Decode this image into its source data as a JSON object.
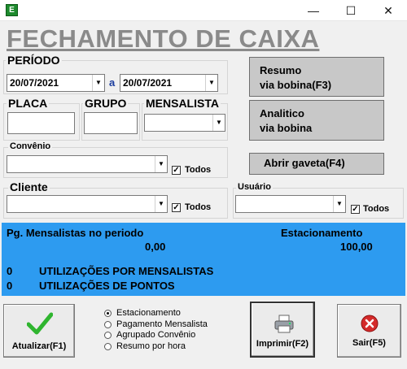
{
  "window": {
    "app_icon": "E",
    "minimize_glyph": "—",
    "maximize_glyph": "☐",
    "close_glyph": "✕"
  },
  "title": "FECHAMENTO DE CAIXA",
  "periodo": {
    "label": "PERÍODO",
    "from": "20/07/2021",
    "separator": "a",
    "to": "20/07/2021"
  },
  "placa": {
    "label": "PLACA",
    "value": ""
  },
  "grupo": {
    "label": "GRUPO",
    "value": ""
  },
  "mensalista": {
    "label": "MENSALISTA",
    "value": ""
  },
  "convenio": {
    "label": "Convênio",
    "value": "",
    "todos_label": "Todos",
    "todos_checked": true
  },
  "cliente": {
    "label": "Cliente",
    "value": "",
    "todos_label": "Todos",
    "todos_checked": true
  },
  "usuario": {
    "label": "Usuário",
    "value": "",
    "todos_label": "Todos",
    "todos_checked": true
  },
  "buttons": {
    "resumo_line1": "Resumo",
    "resumo_line2": "via bobina(F3)",
    "analitico_line1": "Analitico",
    "analitico_line2": "via bobina",
    "abrir_gaveta": "Abrir gaveta(F4)",
    "atualizar": "Atualizar(F1)",
    "imprimir": "Imprimir(F2)",
    "sair": "Sair(F5)"
  },
  "summary": {
    "mensalistas_label": "Pg. Mensalistas no periodo",
    "mensalistas_value": "0,00",
    "estacionamento_label": "Estacionamento",
    "estacionamento_value": "100,00",
    "util_mensalistas_count": "0",
    "util_mensalistas_label": "UTILIZAÇÕES POR MENSALISTAS",
    "util_pontos_count": "0",
    "util_pontos_label": "UTILIZAÇÕES DE PONTOS"
  },
  "report_options": {
    "selected": "Estacionamento",
    "items": [
      "Estacionamento",
      "Pagamento Mensalista",
      "Agrupado Convênio",
      "Resumo por hora"
    ]
  },
  "colors": {
    "panel_blue": "#2d9bf0",
    "title_gray": "#8a8a8a",
    "check_green": "#2fb52f",
    "exit_red": "#d42a2a"
  },
  "icons": {
    "atualizar": "checkmark-icon",
    "imprimir": "printer-icon",
    "sair": "exit-x-icon"
  }
}
